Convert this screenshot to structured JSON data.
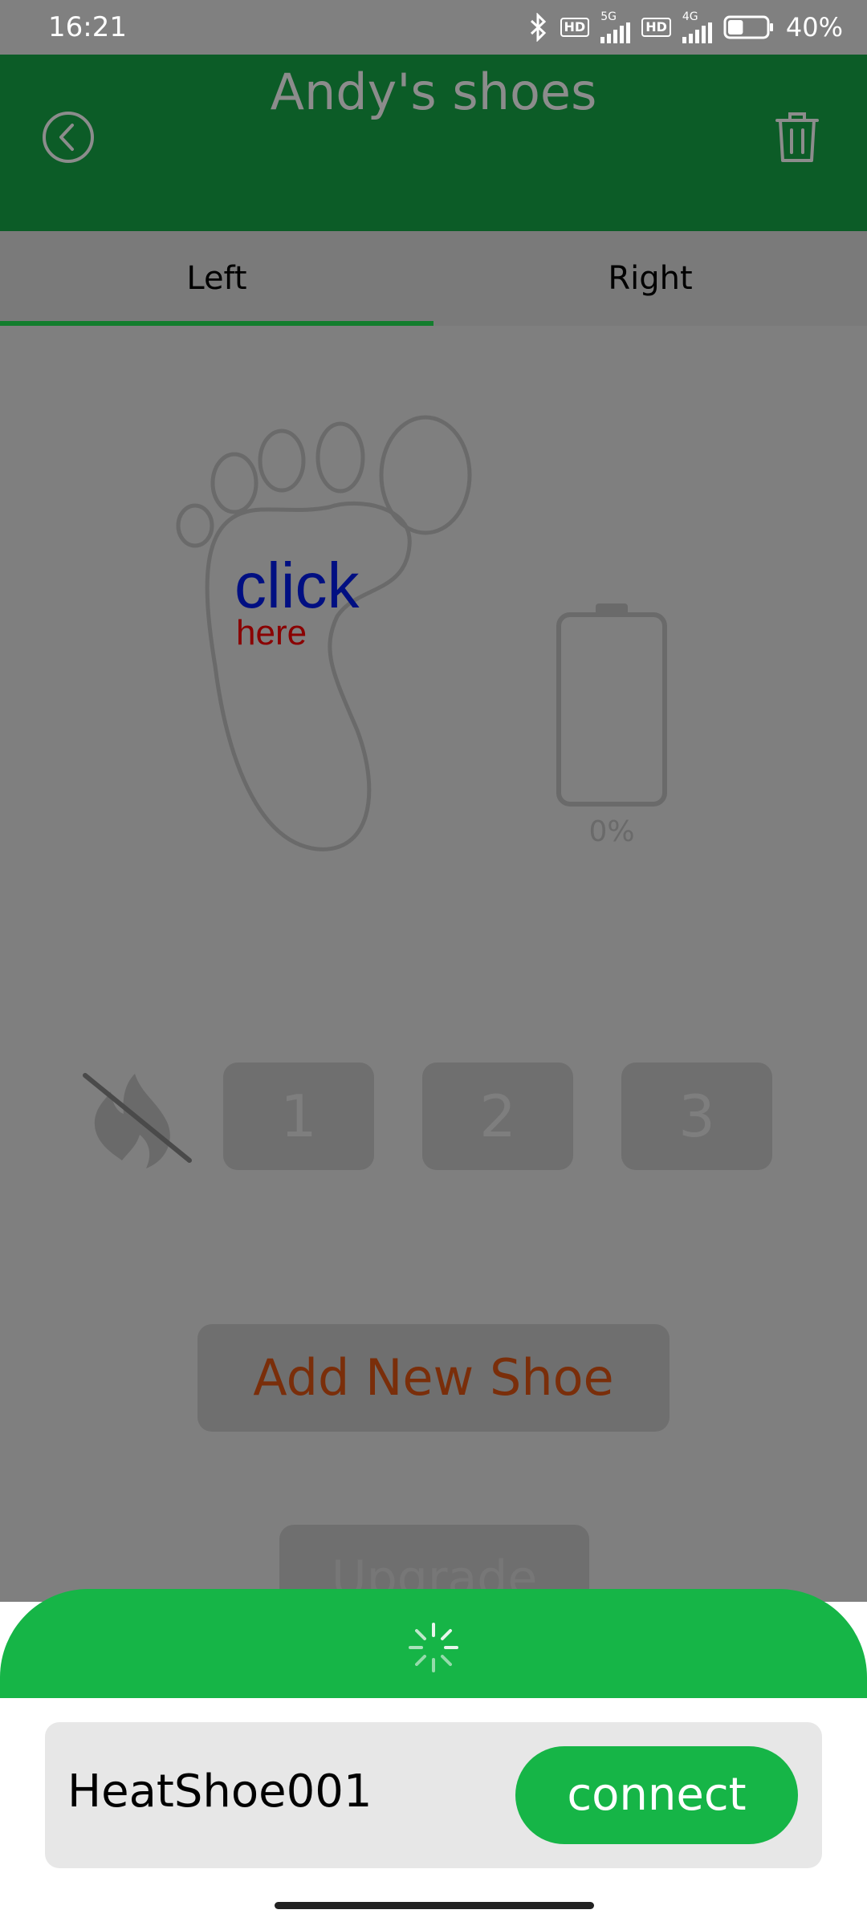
{
  "status_bar": {
    "time": "16:21",
    "network_5g": "5G",
    "network_4g": "4G",
    "hd_badge": "HD",
    "battery": "40%",
    "battery_level": 0.4,
    "icons": [
      "bluetooth-icon",
      "signal-icon",
      "battery-icon"
    ]
  },
  "header": {
    "title": "Andy's shoes",
    "back_icon": "chevron-left-circle-icon",
    "trash_icon": "trash-icon",
    "bg_color": "#0c5c27"
  },
  "tabs": [
    {
      "label": "Left",
      "active": true
    },
    {
      "label": "Right",
      "active": false
    }
  ],
  "foot": {
    "click_text": "click",
    "here_text": "here"
  },
  "battery_widget": {
    "percent_label": "0%",
    "level": 0
  },
  "heat": {
    "off_icon": "flame-off-icon",
    "levels": [
      "1",
      "2",
      "3"
    ]
  },
  "buttons": {
    "add_new_shoe": "Add New Shoe",
    "upgrade": "Upgrade"
  },
  "bottom_sheet": {
    "spinner_icon": "loading-spinner-icon",
    "device_name": "HeatShoe001",
    "connect_label": "connect",
    "accent_color": "#16b547"
  }
}
